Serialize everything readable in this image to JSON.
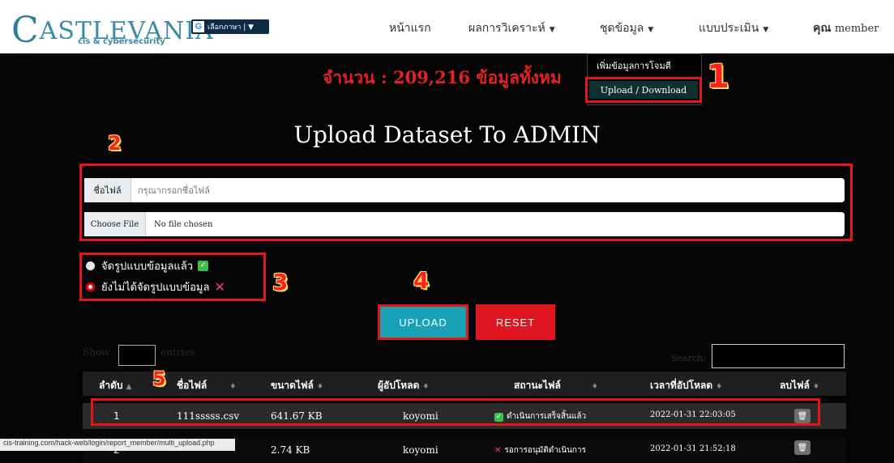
{
  "header": {
    "logo_text": "ASTLEVANIA",
    "logo_letter": "C",
    "logo_sub": "cis & cybersecurity",
    "lang_icon": "G",
    "lang_label": "เลือกภาษา | ▼",
    "nav": [
      {
        "label": "หน้าแรก"
      },
      {
        "label": "ผลการวิเคราะห์"
      },
      {
        "label": "ชุดข้อมูล"
      },
      {
        "label": "แบบประเมิน"
      }
    ],
    "user_prefix": "คุณ",
    "user_name": "member"
  },
  "count_text": "จำนวน : 209,216 ข้อมูลทั้งหม",
  "dropdown": {
    "item1": "เพิ่มข้อมูลการโจมตี",
    "item2": "Upload / Download"
  },
  "markers": [
    "1",
    "2",
    "3",
    "4",
    "5"
  ],
  "title": "Upload Dataset To ADMIN",
  "form": {
    "filename_label": "ชื่อไฟล์",
    "filename_placeholder": "กรุณากรอกชื่อไฟล์",
    "choose_file_label": "Choose File",
    "no_file_text": "No file chosen"
  },
  "radios": {
    "formatted": "จัดรูปแบบข้อมูลแล้ว",
    "not_formatted": "ยังไม่ได้จัดรูปแบบข้อมูล"
  },
  "buttons": {
    "upload": "UPLOAD",
    "reset": "RESET"
  },
  "table_controls": {
    "show": "Show",
    "entries": "entries",
    "search": "Search:"
  },
  "table": {
    "headers": [
      "ลำดับ",
      "ชื่อไฟล์",
      "ขนาดไฟล์",
      "ผู้อัปโหลด",
      "สถานะไฟล์",
      "เวลาที่อัปโหลด",
      "ลบไฟล์"
    ],
    "rows": [
      {
        "no": "1",
        "file": "111sssss.csv",
        "size": "641.67 KB",
        "uploader": "koyomi",
        "status": "ดำเนินการเสร็จสิ้นแล้ว",
        "time": "2022-01-31 22:03:05"
      },
      {
        "no": "2",
        "file": "",
        "size": "2.74 KB",
        "uploader": "koyomi",
        "status": "รอการอนุมัติดำเนินการ",
        "time": "2022-01-31 21:52:18"
      }
    ]
  },
  "status_url": "cis-training.com/hack-web/login/report_member/multi_upload.php",
  "colors": {
    "accent": "#3c8aa6",
    "upload": "#17a2b8",
    "reset": "#e0151f",
    "alert": "#e52222"
  }
}
